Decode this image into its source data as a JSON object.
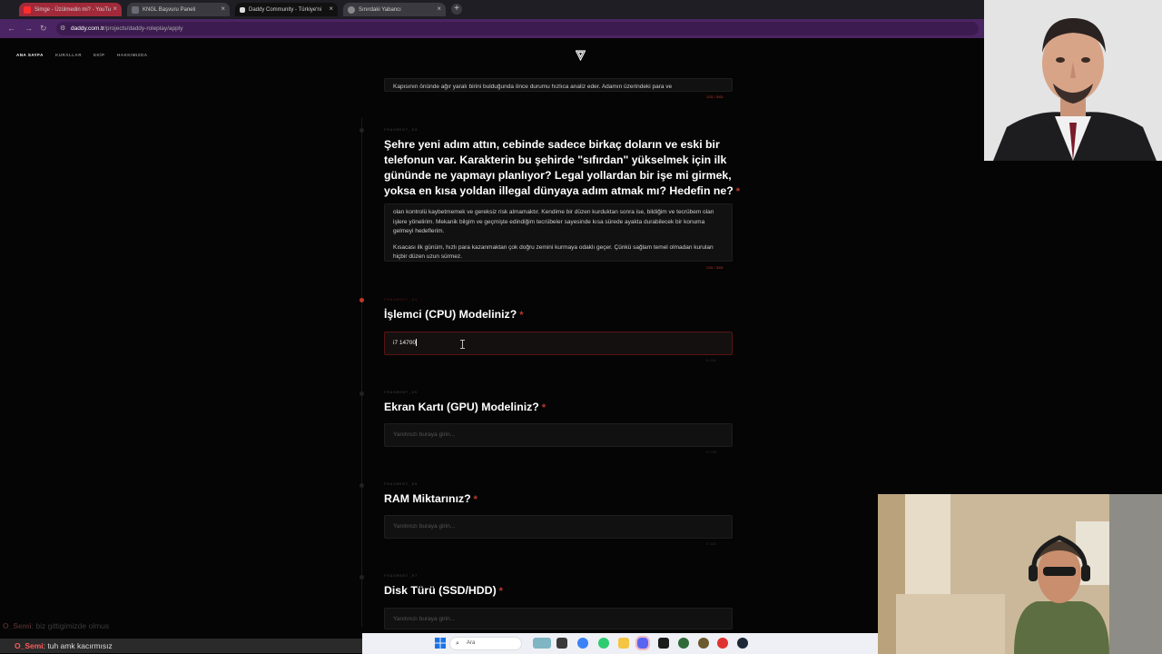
{
  "browser": {
    "tabs": [
      {
        "title": "Simge - Üzülmedin mi? - YouTu",
        "style": "pink"
      },
      {
        "title": "KNGL Başvuru Paneli",
        "style": "gray"
      },
      {
        "title": "Daddy Community - Türkiye'ni",
        "style": "active"
      },
      {
        "title": "Sınırdaki Yabancı",
        "style": "gray"
      }
    ],
    "url_domain": "daddy.com.tr",
    "url_path": "/projects/daddy-roleplay/apply"
  },
  "site_nav": [
    "ANA SAYFA",
    "KURALLAR",
    "EKİP",
    "HAKKIMIZDA"
  ],
  "form": {
    "prev_answer_text": "Kapısının önünde ağır yaralı birini bulduğunda önce durumu hızlıca analiz eder. Adamın üzerindeki para ve",
    "prev_counter": "1231 / 3000",
    "q1": {
      "fragment": "FRAGMENT_03",
      "title": "Şehre yeni adım attın, cebinde sadece birkaç doların ve eski bir telefonun var. Karakterin bu şehirde \"sıfırdan\" yükselmek için ilk gününde ne yapmayı planlıyor? Legal yollardan bir işe mi girmek, yoksa en kısa yoldan illegal dünyaya adım atmak mı? Hedefin ne?",
      "answer_p1": "olan kontrolü kaybetmemek ve gereksiz risk almamaktır. Kendime bir düzen kurduktan sonra ise, bildiğim ve tecrübem olan işlere yönelirim. Mekanik bilgim ve geçmişte edindiğim tecrübeler sayesinde kısa sürede ayakta durabilecek bir konuma gelmeyi hedeflerim.",
      "answer_p2": "Kısacası ilk günüm, hızlı para kazanmaktan çok doğru zemini kurmaya odaklı geçer. Çünkü sağlam temel olmadan kurulan hiçbir düzen uzun sürmez.",
      "counter": "1231 / 3000"
    },
    "q2": {
      "fragment": "FRAGMENT_04",
      "title": "İşlemci (CPU) Modeliniz?",
      "value": "i7 14700",
      "counter": "8 / 100"
    },
    "q3": {
      "fragment": "FRAGMENT_05",
      "title": "Ekran Kartı (GPU) Modeliniz?",
      "placeholder": "Yanıtınızı buraya girin...",
      "counter": "0 / 100"
    },
    "q4": {
      "fragment": "FRAGMENT_06",
      "title": "RAM Miktarınız?",
      "placeholder": "Yanıtınızı buraya girin...",
      "counter": "0 / 100"
    },
    "q5": {
      "fragment": "FRAGMENT_07",
      "title": "Disk Türü (SSD/HDD)",
      "placeholder": "Yanıtınızı buraya girin..."
    },
    "required_mark": "*"
  },
  "chat": {
    "faded": {
      "user": "O_Semi",
      "text": ": biz gittigimizde olmus"
    },
    "current": {
      "user": "O_Semi",
      "text": ": tuh amk kacırmısız"
    }
  },
  "taskbar": {
    "search_label": "Ara"
  },
  "colors": {
    "accent_red": "#c0392b",
    "addr_purple": "#4b2463"
  }
}
